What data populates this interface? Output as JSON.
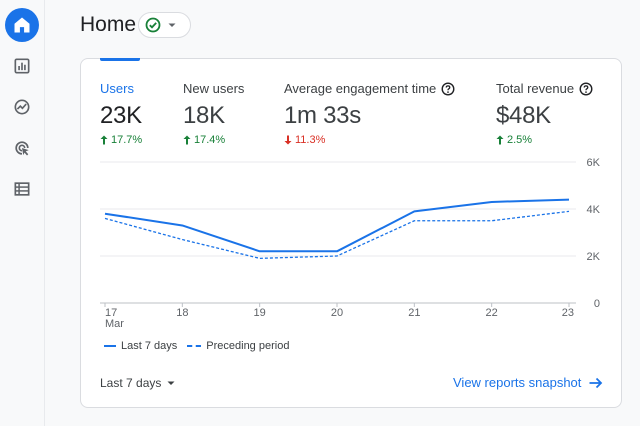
{
  "header": {
    "title": "Home"
  },
  "sidebar": {
    "items": [
      {
        "name": "home",
        "icon": "home-icon",
        "active": true
      },
      {
        "name": "reports",
        "icon": "bar-chart-icon",
        "active": false
      },
      {
        "name": "explore",
        "icon": "explore-icon",
        "active": false
      },
      {
        "name": "advertising",
        "icon": "advertising-icon",
        "active": false
      },
      {
        "name": "configure",
        "icon": "list-icon",
        "active": false
      }
    ]
  },
  "metrics": [
    {
      "label": "Users",
      "value": "23K",
      "change": "17.7%",
      "direction": "up",
      "help": false
    },
    {
      "label": "New users",
      "value": "18K",
      "change": "17.4%",
      "direction": "up",
      "help": false
    },
    {
      "label": "Average engagement time",
      "value": "1m 33s",
      "change": "11.3%",
      "direction": "down",
      "help": true
    },
    {
      "label": "Total revenue",
      "value": "$48K",
      "change": "2.5%",
      "direction": "up",
      "help": true
    }
  ],
  "legend": {
    "current": "Last 7 days",
    "previous": "Preceding period"
  },
  "footer": {
    "date_range": "Last 7 days",
    "view_link": "View reports snapshot"
  },
  "colors": {
    "accent": "#1a73e8",
    "positive": "#188038",
    "negative": "#d93025"
  },
  "chart_data": {
    "type": "line",
    "categories": [
      "17",
      "18",
      "19",
      "20",
      "21",
      "22",
      "23"
    ],
    "x_month_label": "Mar",
    "y_ticks": [
      "6K",
      "4K",
      "2K",
      "0"
    ],
    "ylim": [
      0,
      6000
    ],
    "y_axis_side": "right",
    "series": [
      {
        "name": "Last 7 days",
        "style": "solid",
        "values": [
          3800,
          3300,
          2200,
          2200,
          3900,
          4300,
          4400
        ]
      },
      {
        "name": "Preceding period",
        "style": "dashed",
        "values": [
          3600,
          2700,
          1900,
          2000,
          3500,
          3500,
          3900
        ]
      }
    ]
  }
}
